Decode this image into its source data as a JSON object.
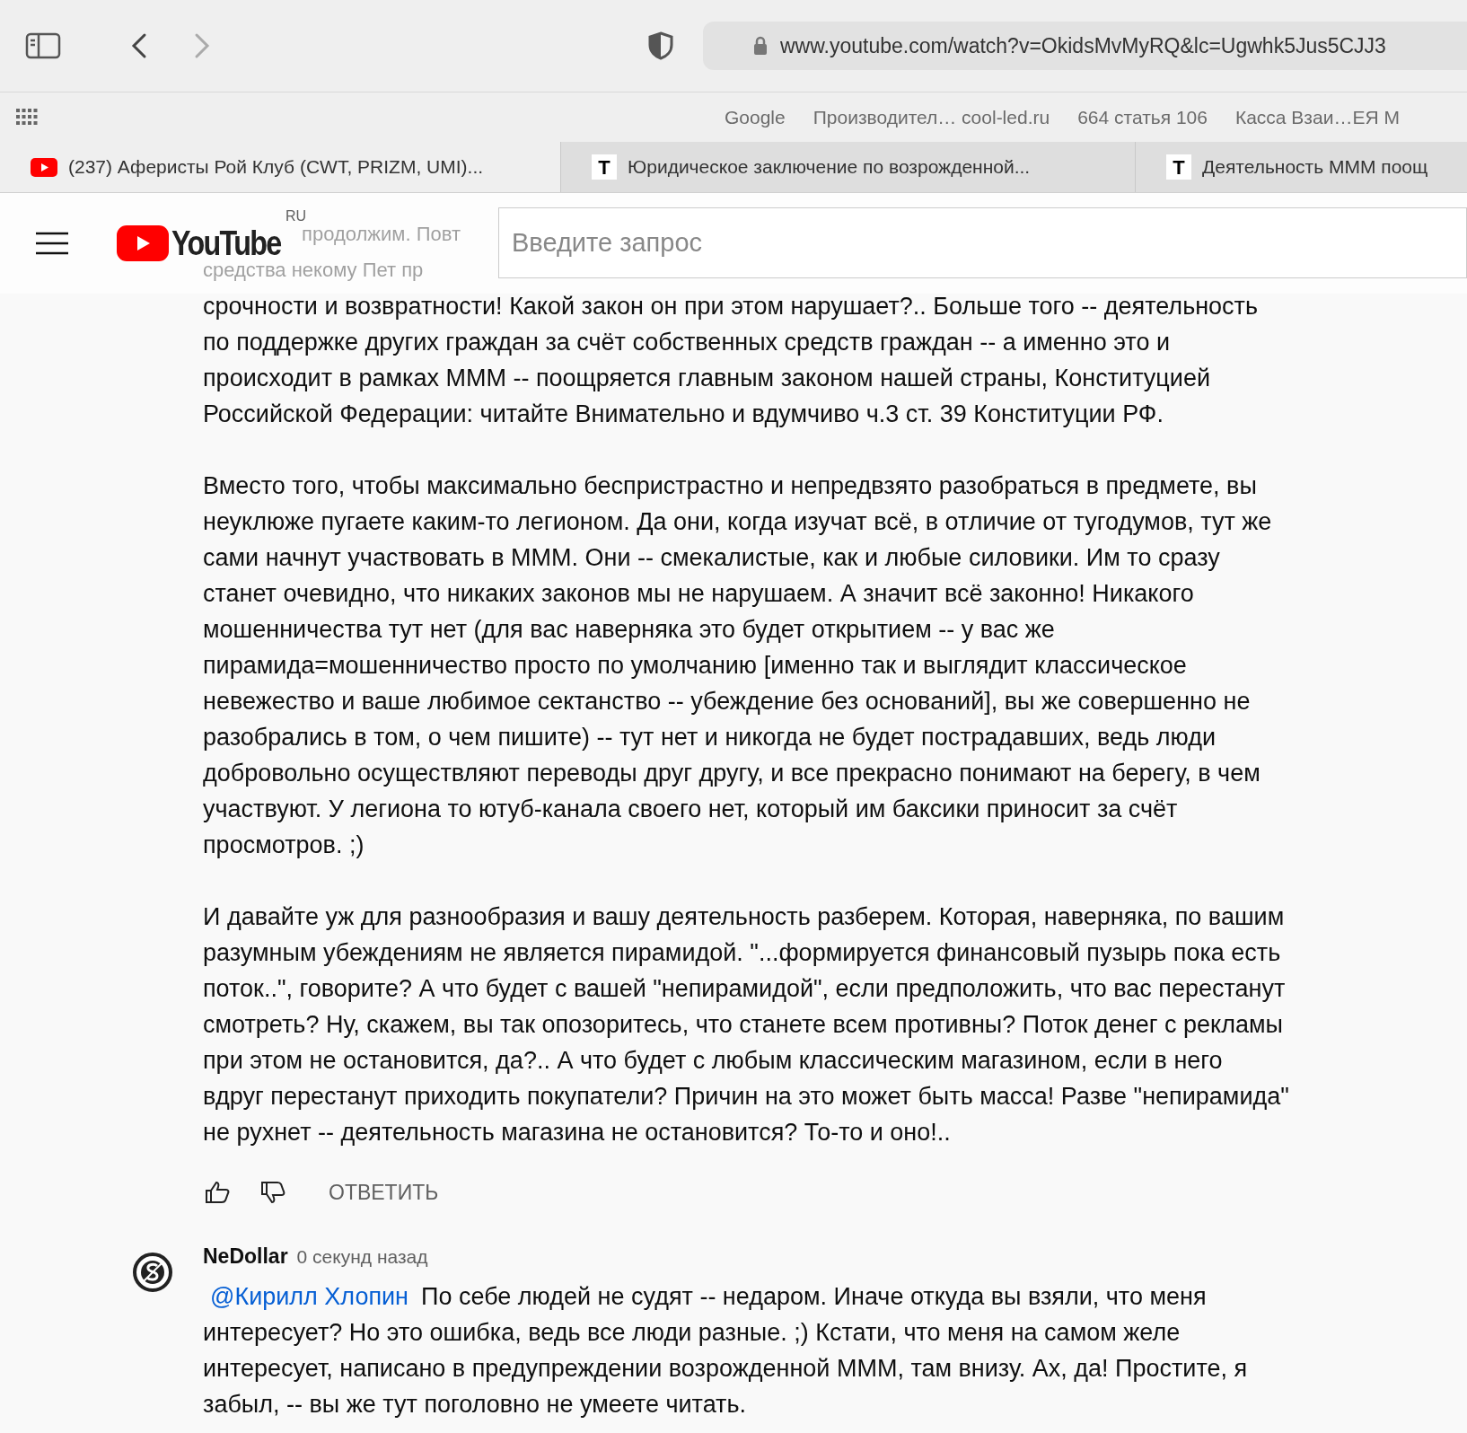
{
  "toolbar": {
    "url": "www.youtube.com/watch?v=OkidsMvMyRQ&lc=Ugwhk5Jus5CJJ3"
  },
  "bookmarks": [
    "Google",
    "Производител… cool-led.ru",
    "664 статья 106",
    "Касса Взаи…ЕЯ М"
  ],
  "tabs": [
    {
      "title": "(237) Аферисты Рой Клуб (CWT, PRIZM, UMI)...",
      "selected": true,
      "kind": "youtube"
    },
    {
      "title": "Юридическое заключение по возрожденной...",
      "selected": false,
      "kind": "letter",
      "letter": "T"
    },
    {
      "title": "Деятельность МММ поощ",
      "selected": false,
      "kind": "letter",
      "letter": "T"
    }
  ],
  "header": {
    "logo": "YouTube",
    "region": "RU",
    "search_placeholder": "Введите запрос"
  },
  "comment": {
    "hidden_lines": [
      "продолжим. Повт",
      "средства некому Пет пр"
    ],
    "paragraphs": [
      [
        "срочности и возвратности! Какой закон он при этом нарушает?.. Больше того -- деятельность",
        "по поддержке других граждан за счёт собственных средств граждан -- а именно это и",
        "происходит в рамках МММ -- поощряется главным законом нашей страны, Конституцией",
        "Российской Федерации: читайте Внимательно и вдумчиво ч.3 ст. 39 Конституции РФ."
      ],
      [
        "Вместо того, чтобы максимально беспристрастно и непредвзято разобраться в предмете, вы",
        "неуклюже пугаете каким-то легионом. Да они, когда изучат всё, в отличие от тугодумов, тут же",
        "сами начнут участвовать в МММ. Они -- смекалистые, как и любые силовики. Им то сразу",
        "станет очевидно, что никаких законов мы не нарушаем. А значит всё законно! Никакого",
        "мошенничества тут нет (для вас наверняка это будет открытием -- у вас же",
        "пирамида=мошенничество просто по умолчанию [именно так и выглядит классическое",
        "невежество и ваше любимое сектанство -- убеждение без оснований], вы же совершенно не",
        "разобрались в том, о чем пишите) -- тут нет и никогда не будет пострадавших, ведь люди",
        "добровольно осуществляют переводы друг другу, и все прекрасно понимают на берегу, в чем",
        "участвуют. У легиона то ютуб-канала своего нет, который им баксики приносит за счёт",
        "просмотров. ;)"
      ],
      [
        "И давайте уж для разнообразия и вашу деятельность разберем. Которая, наверняка, по вашим",
        "разумным убеждениям не является пирамидой. \"...формируется финансовый пузырь пока есть",
        "поток..\", говорите? А что будет с вашей \"непирамидой\", если предположить, что вас перестанут",
        "смотреть? Ну, скажем, вы так опозоритесь, что станете всем противны? Поток денег с рекламы",
        "при этом не остановится, да?.. А что будет с любым классическим магазином, если в него",
        "вдруг перестанут приходить покупатели? Причин на это может быть масса! Разве \"непирамида\"",
        "не рухнет -- деятельность магазина не остановится? То-то и оно!.."
      ]
    ],
    "reply_button": "ОТВЕТИТЬ"
  },
  "reply": {
    "author": "NeDollar",
    "time": "0 секунд назад",
    "mention": "@Кирилл Хлопин",
    "lines": [
      "По себе людей не судят -- недаром. Иначе откуда вы взяли, что меня",
      "интересует? Но это ошибка, ведь все люди разные. ;) Кстати, что меня на самом желе",
      "интересует, написано в предупреждении возрожденной МММ, там внизу. Ах, да! Простите, я",
      "забыл, -- вы же тут поголовно не умеете читать."
    ]
  }
}
